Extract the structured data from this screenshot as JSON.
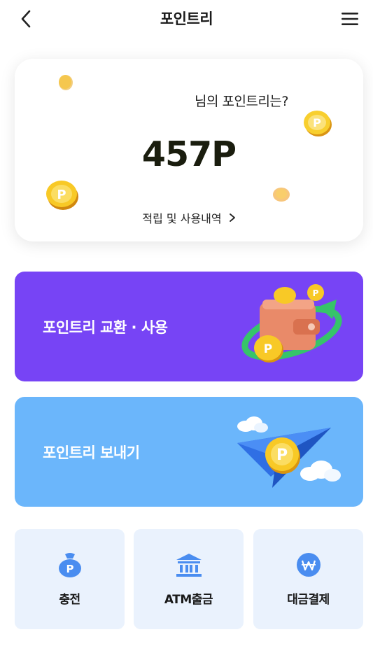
{
  "header": {
    "title": "포인트리",
    "back_icon": "chevron-left-icon",
    "menu_icon": "hamburger-menu-icon"
  },
  "balance": {
    "label": "님의 포인트리는?",
    "value": "457P",
    "history_link": "적립 및 사용내역"
  },
  "actions": [
    {
      "label": "포인트리 교환 · 사용",
      "illustration": "wallet-coins-illustration",
      "color": "#7744f5"
    },
    {
      "label": "포인트리 보내기",
      "illustration": "paper-plane-coin-illustration",
      "color": "#6bb6fb"
    }
  ],
  "tiles": [
    {
      "label": "충전",
      "icon": "money-bag-icon"
    },
    {
      "label": "ATM출금",
      "icon": "bank-icon"
    },
    {
      "label": "대금결제",
      "icon": "won-coin-icon"
    }
  ],
  "colors": {
    "accent_blue": "#4a8df0",
    "coin_gold": "#f5c21b",
    "tile_bg": "#eaf2fd"
  }
}
